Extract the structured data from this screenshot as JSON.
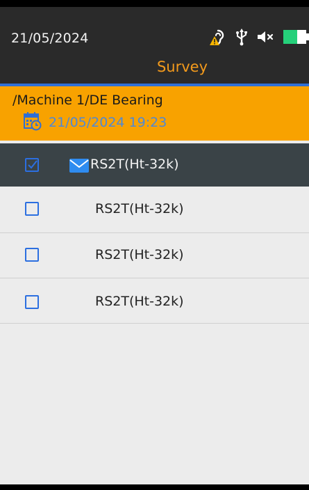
{
  "status_bar": {
    "date": "21/05/2024",
    "icons": [
      "hearing-warning-icon",
      "usb-icon",
      "mute-icon",
      "battery-icon"
    ],
    "battery_level": 0.6
  },
  "title": "Survey",
  "header": {
    "path": "/Machine 1/DE Bearing",
    "datetime": "21/05/2024 19:23",
    "icon": "calendar-icon"
  },
  "rows": [
    {
      "label": "RS2T(Ht-32k)",
      "checked": true,
      "selected": true,
      "icon": "mail-icon"
    },
    {
      "label": "RS2T(Ht-32k)",
      "checked": false,
      "selected": false
    },
    {
      "label": "RS2T(Ht-32k)",
      "checked": false,
      "selected": false
    },
    {
      "label": "RS2T(Ht-32k)",
      "checked": false,
      "selected": false
    }
  ],
  "colors": {
    "accent_orange": "#f8a200",
    "title_orange": "#f39a1c",
    "blue": "#2c6fe0",
    "dark": "#2a2a2a",
    "selected_row": "#3a4347"
  }
}
